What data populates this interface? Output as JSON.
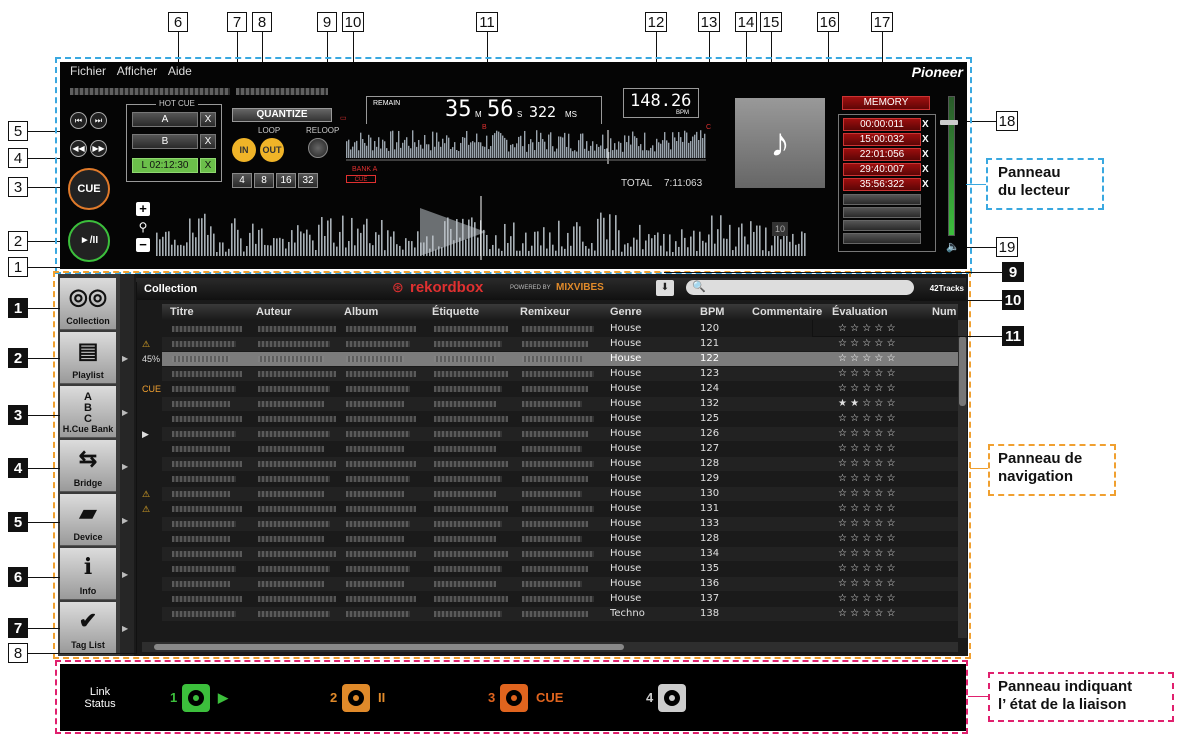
{
  "menu": [
    "Fichier",
    "Afficher",
    "Aide"
  ],
  "brand": "Pioneer",
  "player": {
    "hot_cue_title": "HOT CUE",
    "hot_cues": [
      {
        "label": "A",
        "x": "X"
      },
      {
        "label": "B",
        "x": "X"
      },
      {
        "label": "L 02:12:30",
        "x": "X"
      }
    ],
    "quantize_label": "QUANTIZE",
    "loop_label": "LOOP",
    "reloop_label": "RELOOP",
    "loop_in": "IN",
    "loop_out": "OUT",
    "loop_sizes": [
      "4",
      "8",
      "16",
      "32"
    ],
    "cue_label": "CUE",
    "play_label": "►/II",
    "remain_label": "REMAIN",
    "time_m": "35",
    "time_m_unit": "M",
    "time_s": "56",
    "time_s_unit": "S",
    "time_ms": "322",
    "time_ms_unit": "MS",
    "bpm_value": "148.26",
    "bpm_unit": "BPM",
    "total_label": "TOTAL",
    "total_value": "7:11:063",
    "bank_a_label": "BANK A",
    "memory_label": "MEMORY",
    "memory_points": [
      "00:00:011",
      "15:00:032",
      "22:01:056",
      "29:40:007",
      "35:56:322"
    ],
    "memory_x": "X",
    "track_number_badge": "10",
    "waveform_mark_b": "B",
    "waveform_mark_c": "C"
  },
  "nav": {
    "sidebar": [
      {
        "label": "Collection",
        "icon": "collection-icon"
      },
      {
        "label": "Playlist",
        "icon": "playlist-icon"
      },
      {
        "label": "H.Cue Bank",
        "icon": "hcue-bank-icon"
      },
      {
        "label": "Bridge",
        "icon": "bridge-icon"
      },
      {
        "label": "Device",
        "icon": "device-icon"
      },
      {
        "label": "Info",
        "icon": "info-icon"
      },
      {
        "label": "Tag List",
        "icon": "tag-list-icon"
      }
    ],
    "title": "Collection",
    "logo_text": "rekordbox",
    "powered_by": "POWERED BY",
    "mixvibes": "MIXVIBES",
    "search_placeholder": "",
    "track_count": "42Tracks",
    "columns": [
      "Titre",
      "Auteur",
      "Album",
      "Étiquette",
      "Remixeur",
      "Genre",
      "BPM",
      "Commentaire",
      "Évaluation",
      "Num"
    ],
    "rows": [
      {
        "genre": "House",
        "bpm": "120",
        "rating": "☆ ☆ ☆ ☆ ☆",
        "mark": ""
      },
      {
        "genre": "House",
        "bpm": "121",
        "rating": "☆ ☆ ☆ ☆ ☆",
        "mark": "⚠"
      },
      {
        "genre": "House",
        "bpm": "122",
        "rating": "☆ ☆ ☆ ☆ ☆",
        "mark": "45%"
      },
      {
        "genre": "House",
        "bpm": "123",
        "rating": "☆ ☆ ☆ ☆ ☆",
        "mark": ""
      },
      {
        "genre": "House",
        "bpm": "124",
        "rating": "☆ ☆ ☆ ☆ ☆",
        "mark": "CUE"
      },
      {
        "genre": "House",
        "bpm": "132",
        "rating": "★ ★ ☆ ☆ ☆",
        "mark": ""
      },
      {
        "genre": "House",
        "bpm": "125",
        "rating": "☆ ☆ ☆ ☆ ☆",
        "mark": ""
      },
      {
        "genre": "House",
        "bpm": "126",
        "rating": "☆ ☆ ☆ ☆ ☆",
        "mark": "▶"
      },
      {
        "genre": "House",
        "bpm": "127",
        "rating": "☆ ☆ ☆ ☆ ☆",
        "mark": ""
      },
      {
        "genre": "House",
        "bpm": "128",
        "rating": "☆ ☆ ☆ ☆ ☆",
        "mark": ""
      },
      {
        "genre": "House",
        "bpm": "129",
        "rating": "☆ ☆ ☆ ☆ ☆",
        "mark": ""
      },
      {
        "genre": "House",
        "bpm": "130",
        "rating": "☆ ☆ ☆ ☆ ☆",
        "mark": "⚠"
      },
      {
        "genre": "House",
        "bpm": "131",
        "rating": "☆ ☆ ☆ ☆ ☆",
        "mark": "⚠"
      },
      {
        "genre": "House",
        "bpm": "133",
        "rating": "☆ ☆ ☆ ☆ ☆",
        "mark": ""
      },
      {
        "genre": "House",
        "bpm": "128",
        "rating": "☆ ☆ ☆ ☆ ☆",
        "mark": ""
      },
      {
        "genre": "House",
        "bpm": "134",
        "rating": "☆ ☆ ☆ ☆ ☆",
        "mark": ""
      },
      {
        "genre": "House",
        "bpm": "135",
        "rating": "☆ ☆ ☆ ☆ ☆",
        "mark": ""
      },
      {
        "genre": "House",
        "bpm": "136",
        "rating": "☆ ☆ ☆ ☆ ☆",
        "mark": ""
      },
      {
        "genre": "House",
        "bpm": "137",
        "rating": "☆ ☆ ☆ ☆ ☆",
        "mark": ""
      },
      {
        "genre": "Techno",
        "bpm": "138",
        "rating": "☆ ☆ ☆ ☆ ☆",
        "mark": ""
      }
    ]
  },
  "link": {
    "title_line1": "Link",
    "title_line2": "Status",
    "decks": [
      {
        "num": "1",
        "state": "▶",
        "color": "#3cbf3c"
      },
      {
        "num": "2",
        "state": "II",
        "color": "#e08a2a"
      },
      {
        "num": "3",
        "state": "CUE",
        "color": "#e0641e"
      },
      {
        "num": "4",
        "state": "",
        "color": "#cccccc"
      }
    ]
  },
  "panel_labels": {
    "player": [
      "Panneau",
      "du lecteur"
    ],
    "nav": [
      "Panneau de",
      "navigation"
    ],
    "link": [
      "Panneau indiquant",
      "l’ état de la liaison"
    ]
  },
  "callouts_top": [
    "6",
    "7",
    "8",
    "9",
    "10",
    "11",
    "12",
    "13",
    "14",
    "15",
    "16",
    "17",
    "18",
    "19"
  ],
  "callouts_left": [
    "5",
    "4",
    "3",
    "2",
    "1"
  ],
  "callouts_nav_left": [
    "1",
    "2",
    "3",
    "4",
    "5",
    "6",
    "7",
    "8"
  ],
  "callouts_nav_right": [
    "9",
    "10",
    "11"
  ],
  "colors": {
    "player_border": "#39a8e0",
    "nav_border": "#f0a030",
    "link_border": "#e0206e",
    "memory_red": "#9c0e0e"
  }
}
